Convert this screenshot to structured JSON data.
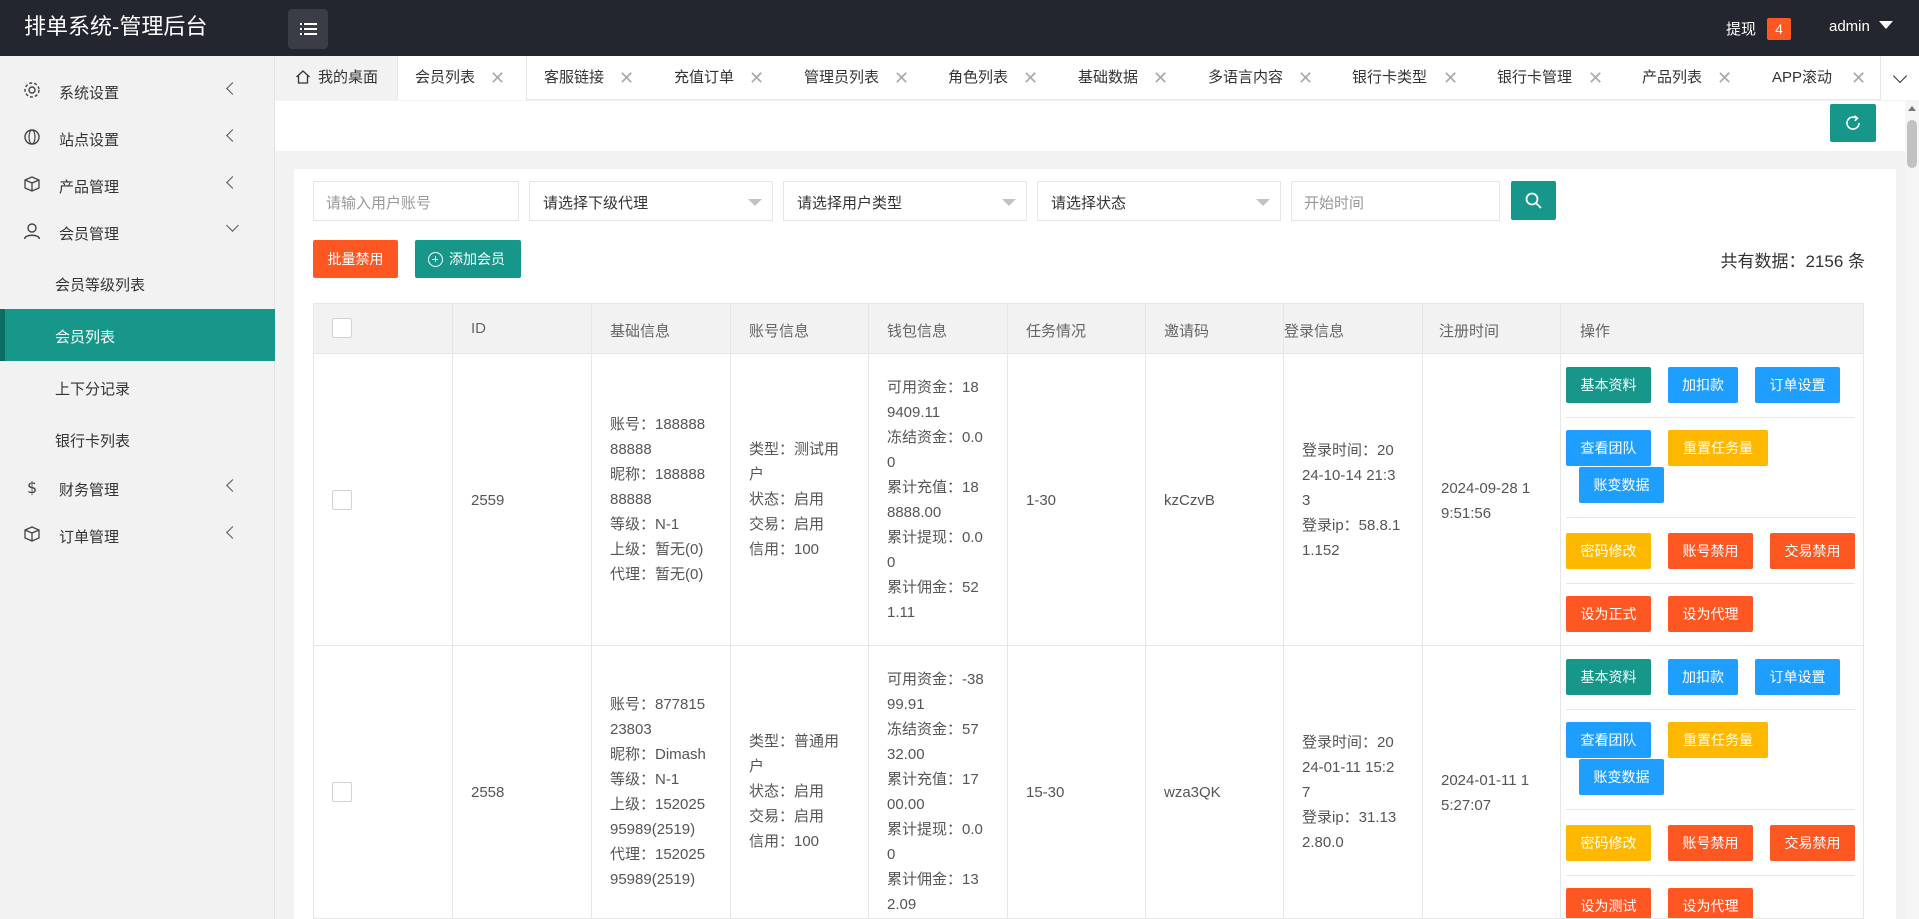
{
  "header": {
    "title": "排单系统-管理后台",
    "withdraw_label": "提现",
    "withdraw_count": "4",
    "user_name": "admin"
  },
  "sidebar": {
    "items": [
      {
        "label": "系统设置",
        "icon": "gear-icon"
      },
      {
        "label": "站点设置",
        "icon": "globe-icon"
      },
      {
        "label": "产品管理",
        "icon": "box-icon"
      },
      {
        "label": "会员管理",
        "icon": "user-icon"
      },
      {
        "label": "财务管理",
        "icon": "dollar-icon"
      },
      {
        "label": "订单管理",
        "icon": "box-icon"
      }
    ],
    "sub_items": [
      {
        "label": "会员等级列表"
      },
      {
        "label": "会员列表"
      },
      {
        "label": "上下分记录"
      },
      {
        "label": "银行卡列表"
      }
    ],
    "active_color": "#17978a"
  },
  "tabs": [
    {
      "label": "我的桌面"
    },
    {
      "label": "会员列表"
    },
    {
      "label": "客服链接"
    },
    {
      "label": "充值订单"
    },
    {
      "label": "管理员列表"
    },
    {
      "label": "角色列表"
    },
    {
      "label": "基础数据"
    },
    {
      "label": "多语言内容"
    },
    {
      "label": "银行卡类型"
    },
    {
      "label": "银行卡管理"
    },
    {
      "label": "产品列表"
    },
    {
      "label": "APP滚动"
    }
  ],
  "filters": {
    "account_placeholder": "请输入用户账号",
    "agent_select": "请选择下级代理",
    "user_type_select": "请选择用户类型",
    "status_select": "请选择状态",
    "start_time_placeholder": "开始时间"
  },
  "actions": {
    "batch_disable": "批量禁用",
    "add_member": "添加会员",
    "total_text": "共有数据：2156 条"
  },
  "table": {
    "columns": [
      "ID",
      "基础信息",
      "账号信息",
      "钱包信息",
      "任务情况",
      "邀请码",
      "登录信息",
      "注册时间",
      "操作"
    ],
    "rows": [
      {
        "id": "2559",
        "basic": "账号：188888\n88888\n昵称：188888\n88888\n等级：N-1\n上级：暂无(0)\n代理：暂无(0)",
        "account": "类型：测试用\n户\n状态：启用\n交易：启用\n信用：100",
        "wallet": "可用资金：18\n9409.11\n冻结资金：0.0\n0\n累计充值：18\n8888.00\n累计提现：0.0\n0\n累计佣金：52\n1.11",
        "task": "1-30",
        "invite": "kzCzvB",
        "login": "登录时间：20\n24-10-14 21:3\n3\n登录ip：58.8.1\n1.152",
        "register": "2024-09-28 1\n9:51:56",
        "ops": [
          "基本资料",
          "加扣款",
          "订单设置",
          "查看团队",
          "重置任务量",
          "账变数据",
          "密码修改",
          "账号禁用",
          "交易禁用",
          "设为正式",
          "设为代理"
        ]
      },
      {
        "id": "2558",
        "basic": "账号：877815\n23803\n昵称：Dimash\n等级：N-1\n上级：152025\n95989(2519)\n代理：152025\n95989(2519)",
        "account": "类型：普通用\n户\n状态：启用\n交易：启用\n信用：100",
        "wallet": "可用资金：-38\n99.91\n冻结资金：57\n32.00\n累计充值：17\n00.00\n累计提现：0.0\n0\n累计佣金：13\n2.09",
        "task": "15-30",
        "invite": "wza3QK",
        "login": "登录时间：20\n24-01-11 15:2\n7\n登录ip：31.13\n2.80.0",
        "register": "2024-01-11 1\n5:27:07",
        "ops": [
          "基本资料",
          "加扣款",
          "订单设置",
          "查看团队",
          "重置任务量",
          "账变数据",
          "密码修改",
          "账号禁用",
          "交易禁用",
          "设为测试",
          "设为代理"
        ]
      }
    ]
  },
  "colors": {
    "teal": "#17978a",
    "blue": "#1e9fff",
    "orange": "#ffb800",
    "red": "#ff5722",
    "header_bg": "#23262e"
  }
}
